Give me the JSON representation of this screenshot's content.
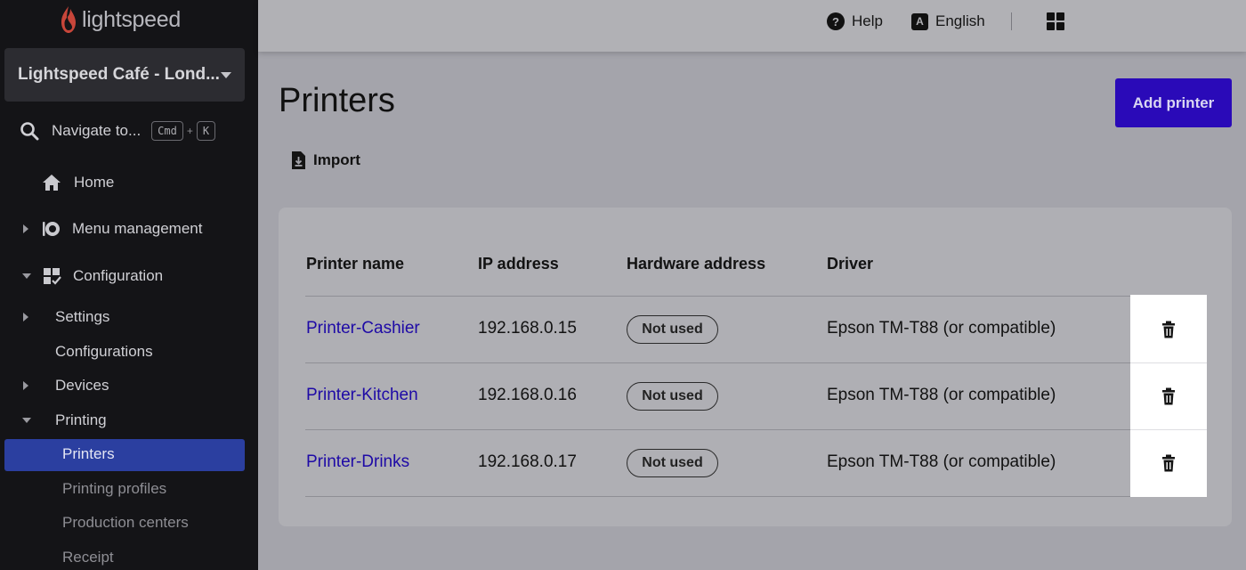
{
  "brand": {
    "logo_text": "lightspeed",
    "flame_color": "#c8463a"
  },
  "sidebar": {
    "location": "Lightspeed Café - Lond...",
    "search": {
      "label": "Navigate to...",
      "key1": "Cmd",
      "plus": "+",
      "key2": "K"
    },
    "items": [
      {
        "label": "Home"
      },
      {
        "label": "Menu management"
      },
      {
        "label": "Configuration"
      },
      {
        "label": "Settings"
      },
      {
        "label": "Configurations"
      },
      {
        "label": "Devices"
      },
      {
        "label": "Printing"
      },
      {
        "label": "Printers"
      },
      {
        "label": "Printing profiles"
      },
      {
        "label": "Production centers"
      },
      {
        "label": "Receipt"
      }
    ]
  },
  "topbar": {
    "help": "Help",
    "language_icon": "A",
    "language": "English"
  },
  "main": {
    "title": "Printers",
    "add_button": "Add printer",
    "import_label": "Import",
    "table": {
      "headers": [
        "Printer name",
        "IP address",
        "Hardware address",
        "Driver"
      ],
      "rows": [
        {
          "name": "Printer-Cashier",
          "ip": "192.168.0.15",
          "hardware": "Not used",
          "driver": "Epson TM-T88 (or compatible)"
        },
        {
          "name": "Printer-Kitchen",
          "ip": "192.168.0.16",
          "hardware": "Not used",
          "driver": "Epson TM-T88 (or compatible)"
        },
        {
          "name": "Printer-Drinks",
          "ip": "192.168.0.17",
          "hardware": "Not used",
          "driver": "Epson TM-T88 (or compatible)"
        }
      ]
    }
  },
  "colors": {
    "accent": "#2a0ab8",
    "link": "#1e0aa6",
    "sidebar_active": "#2b3fa0",
    "sidebar_bg": "#141417"
  }
}
